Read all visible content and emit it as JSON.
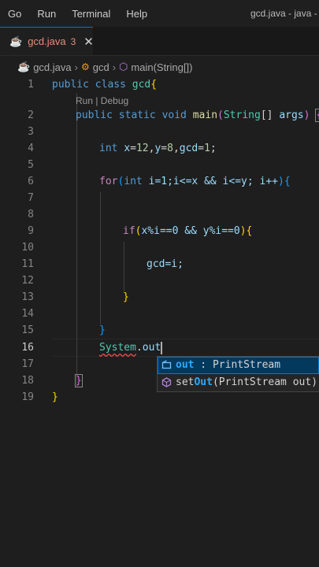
{
  "menu": [
    "Go",
    "Run",
    "Terminal",
    "Help"
  ],
  "window_title": "gcd.java - java - V",
  "tab": {
    "label": "gcd.java",
    "problems": "3",
    "close": "✕"
  },
  "breadcrumb": [
    "gcd.java",
    "gcd",
    "main(String[])"
  ],
  "codelens": "Run | Debug",
  "line_numbers": [
    "1",
    "2",
    "3",
    "4",
    "5",
    "6",
    "7",
    "8",
    "9",
    "10",
    "11",
    "12",
    "13",
    "14",
    "15",
    "16",
    "17",
    "18",
    "19"
  ],
  "active_line": "16",
  "code": {
    "l1_kw": "public class",
    "l1_cls": "gcd",
    "l1_brace": "{",
    "l2_kw": "public static void",
    "l2_fn": "main",
    "l2_open": "(",
    "l2_type": "String",
    "l2_arr": "[]",
    "l2_arg": "args",
    "l2_close": ")",
    "l2_brace": "{",
    "l4_kw": "int",
    "l4_x": "x",
    "l4_eq1": "=",
    "l4_12": "12",
    "l4_c1": ",",
    "l4_y": "y",
    "l4_eq2": "=",
    "l4_8": "8",
    "l4_c2": ",",
    "l4_g": "gcd",
    "l4_eq3": "=",
    "l4_1": "1",
    "l4_end": ";",
    "l6_for": "for",
    "l6_p": "(",
    "l6_int": "int",
    "l6_rest": "i=1;i<=x && i<=y; i++",
    "l6_cp": ")",
    "l6_b": "{",
    "l9_if": "if",
    "l9_p": "(",
    "l9_rest": "x%i==0 && y%i==0",
    "l9_cp": ")",
    "l9_b": "{",
    "l11_g": "gcd",
    "l11_rest": "=i;",
    "l13_b": "}",
    "l15_b": "}",
    "l16_sys": "System",
    "l16_dot": ".",
    "l16_out": "out",
    "l18_b": "}",
    "l19_b": "}"
  },
  "suggestions": [
    {
      "match": "out",
      "rest": "",
      "detail": " : PrintStream",
      "kind": "field-icon",
      "selected": true
    },
    {
      "pre": "set",
      "match": "Out",
      "rest": "(PrintStream out)",
      "detail": " :",
      "kind": "method-icon",
      "selected": false
    }
  ]
}
